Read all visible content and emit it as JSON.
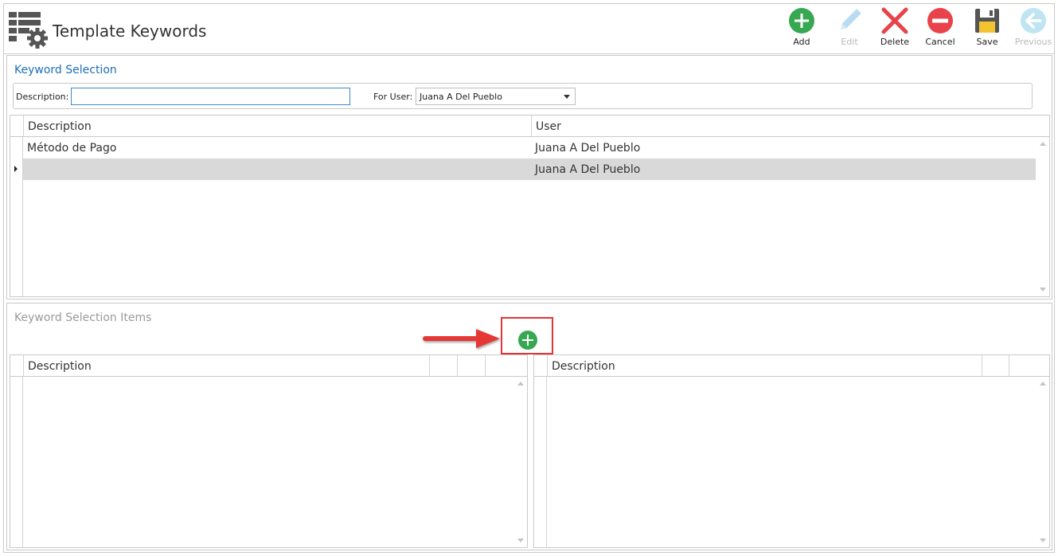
{
  "header": {
    "title": "Template Keywords",
    "app_icon": "table-settings-icon"
  },
  "toolbar": {
    "add_label": "Add",
    "edit_label": "Edit",
    "delete_label": "Delete",
    "cancel_label": "Cancel",
    "save_label": "Save",
    "previous_label": "Previous",
    "icons": [
      "add-icon",
      "pencil-icon",
      "delete-x-icon",
      "cancel-icon",
      "floppy-save-icon",
      "back-arrow-icon"
    ],
    "disabled": [
      "Edit",
      "Previous"
    ]
  },
  "keyword_selection": {
    "title": "Keyword Selection",
    "description_label": "Description:",
    "description_value": "",
    "for_user_label": "For User:",
    "for_user_value": "Juana A Del Pueblo",
    "columns": [
      "Description",
      "User"
    ],
    "rows": [
      {
        "description": "Método de Pago",
        "user": "Juana A Del Pueblo"
      },
      {
        "description": "",
        "user": "Juana A Del Pueblo"
      }
    ],
    "selected_row": 1
  },
  "keyword_items": {
    "title": "Keyword Selection Items",
    "left_columns": [
      "Description"
    ],
    "right_columns": [
      "Description"
    ]
  },
  "colors": {
    "accent_blue": "#1f6fb5",
    "add_green": "#36a852",
    "delete_red": "#e8434a",
    "callout_red": "#e0363a",
    "selected_row": "#d9d9d9"
  }
}
